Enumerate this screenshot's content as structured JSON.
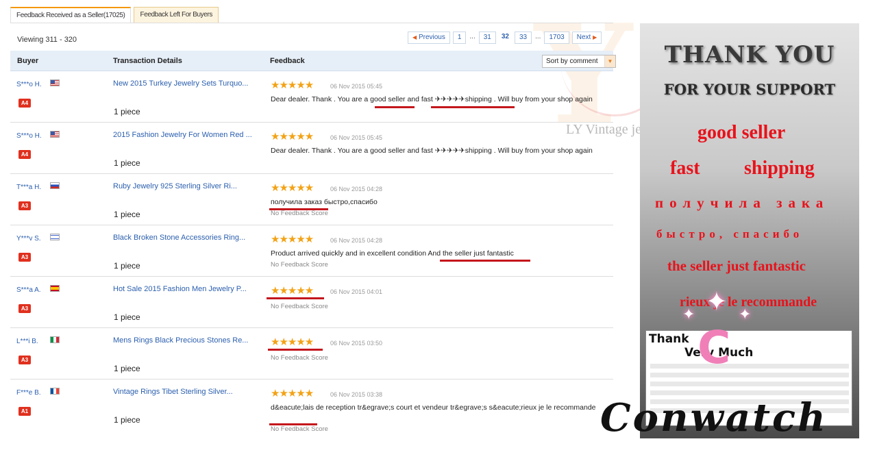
{
  "tabs": [
    {
      "label": "Feedback Received as a Seller(17025)",
      "active": true
    },
    {
      "label": "Feedback Left For Buyers",
      "active": false
    }
  ],
  "viewing": "Viewing 311 - 320",
  "pagination": {
    "previous": "Previous",
    "pages": [
      "1",
      "...",
      "31",
      "32",
      "33",
      "...",
      "1703"
    ],
    "current": "32",
    "next": "Next"
  },
  "table": {
    "headers": {
      "buyer": "Buyer",
      "transaction": "Transaction Details",
      "feedback": "Feedback"
    },
    "sort_label": "Sort by comment",
    "rows": [
      {
        "buyer": "S***o H.",
        "flag": "us",
        "level": "A4",
        "product": "New 2015 Turkey Jewelry Sets Turquo...",
        "qty": "1 piece",
        "rating": 5,
        "date": "06 Nov 2015 05:45",
        "comment": "Dear dealer. Thank . You are a good seller and fast ✈✈✈✈✈shipping . Will buy from your shop again",
        "no_score": ""
      },
      {
        "buyer": "S***o H.",
        "flag": "us",
        "level": "A4",
        "product": "2015 Fashion Jewelry For Women Red ...",
        "qty": "1 piece",
        "rating": 5,
        "date": "06 Nov 2015 05:45",
        "comment": "Dear dealer. Thank . You are a good seller and fast ✈✈✈✈✈shipping . Will buy from your shop again",
        "no_score": ""
      },
      {
        "buyer": "T***a H.",
        "flag": "ru",
        "level": "A3",
        "product": "Ruby Jewelry 925 Sterling Silver Ri...",
        "qty": "1 piece",
        "rating": 5,
        "date": "06 Nov 2015 04:28",
        "comment": "получила заказ быстро,спасибо",
        "no_score": "No Feedback Score"
      },
      {
        "buyer": "Y***v S.",
        "flag": "il",
        "level": "A3",
        "product": "Black Broken Stone Accessories Ring...",
        "qty": "1 piece",
        "rating": 5,
        "date": "06 Nov 2015 04:28",
        "comment": "Product arrived quickly and in excellent condition And the seller just fantastic",
        "no_score": "No Feedback Score"
      },
      {
        "buyer": "S***a A.",
        "flag": "es",
        "level": "A3",
        "product": "Hot Sale 2015 Fashion Men Jewelry P...",
        "qty": "1 piece",
        "rating": 5,
        "date": "06 Nov 2015 04:01",
        "comment": "",
        "no_score": "No Feedback Score"
      },
      {
        "buyer": "L***i B.",
        "flag": "it",
        "level": "A3",
        "product": "Mens Rings Black Precious Stones Re...",
        "qty": "1 piece",
        "rating": 5,
        "date": "06 Nov 2015 03:50",
        "comment": "",
        "no_score": "No Feedback Score"
      },
      {
        "buyer": "F***e B.",
        "flag": "fr",
        "level": "A1",
        "product": "Vintage Rings Tibet Sterling Silver...",
        "qty": "1 piece",
        "rating": 5,
        "date": "06 Nov 2015 03:38",
        "comment": "d&eacute;lais de reception tr&egrave;s court et vendeur tr&egrave;s s&eacute;rieux je le recommande",
        "no_score": "No Feedback Score"
      }
    ]
  },
  "watermark": {
    "text": "LY Vintage jewelry"
  },
  "promo": {
    "thank_you": "THANK YOU",
    "support": "FOR YOUR SUPPORT",
    "good_seller": "good seller",
    "fast": "fast",
    "shipping": "shipping",
    "ru_line1": "получила зака",
    "ru_line2": "быстро, спасибо",
    "fantastic": "the seller just fantastic",
    "recommande": "rieux je le recommande",
    "thumb_title": "Thank",
    "thumb_title2": "Very Much",
    "brand": "Conwatch",
    "brand_initial": "C"
  },
  "colors": {
    "accent_orange": "#f39800",
    "link_blue": "#2b5fae",
    "star": "#f3a215",
    "underline_red": "#c4161c",
    "promo_red": "#e8121b"
  }
}
